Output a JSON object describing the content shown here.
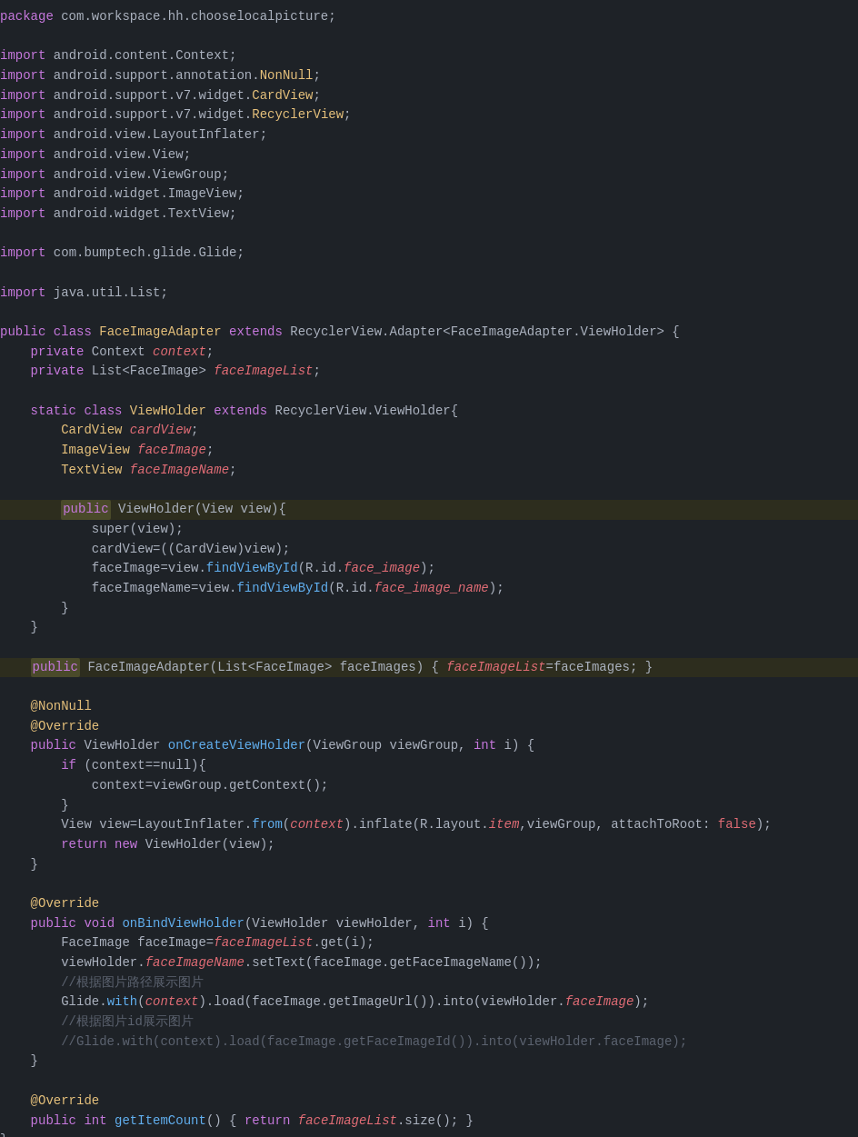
{
  "lines": [
    {
      "id": 1,
      "tokens": [
        {
          "t": "kw-package",
          "v": "package"
        },
        {
          "t": "normal",
          "v": " com.workspace.hh.chooselocalpicture;"
        }
      ]
    },
    {
      "id": 2,
      "tokens": []
    },
    {
      "id": 3,
      "tokens": [
        {
          "t": "kw-import",
          "v": "import"
        },
        {
          "t": "normal",
          "v": " android.content.Context;"
        }
      ]
    },
    {
      "id": 4,
      "tokens": [
        {
          "t": "kw-import",
          "v": "import"
        },
        {
          "t": "normal",
          "v": " android.support.annotation."
        },
        {
          "t": "ann",
          "v": "NonNull"
        },
        {
          "t": "normal",
          "v": ";"
        }
      ]
    },
    {
      "id": 5,
      "tokens": [
        {
          "t": "kw-import",
          "v": "import"
        },
        {
          "t": "normal",
          "v": " android.support.v7.widget."
        },
        {
          "t": "type-name",
          "v": "CardView"
        },
        {
          "t": "normal",
          "v": ";"
        }
      ]
    },
    {
      "id": 6,
      "tokens": [
        {
          "t": "kw-import",
          "v": "import"
        },
        {
          "t": "normal",
          "v": " android.support.v7.widget."
        },
        {
          "t": "type-name",
          "v": "RecyclerView"
        },
        {
          "t": "normal",
          "v": ";"
        }
      ]
    },
    {
      "id": 7,
      "tokens": [
        {
          "t": "kw-import",
          "v": "import"
        },
        {
          "t": "normal",
          "v": " android.view.LayoutInflater;"
        }
      ]
    },
    {
      "id": 8,
      "tokens": [
        {
          "t": "kw-import",
          "v": "import"
        },
        {
          "t": "normal",
          "v": " android.view.View;"
        }
      ]
    },
    {
      "id": 9,
      "tokens": [
        {
          "t": "kw-import",
          "v": "import"
        },
        {
          "t": "normal",
          "v": " android.view.ViewGroup;"
        }
      ]
    },
    {
      "id": 10,
      "tokens": [
        {
          "t": "kw-import",
          "v": "import"
        },
        {
          "t": "normal",
          "v": " android.widget.ImageView;"
        }
      ]
    },
    {
      "id": 11,
      "tokens": [
        {
          "t": "kw-import",
          "v": "import"
        },
        {
          "t": "normal",
          "v": " android.widget.TextView;"
        }
      ]
    },
    {
      "id": 12,
      "tokens": []
    },
    {
      "id": 13,
      "tokens": [
        {
          "t": "kw-import",
          "v": "import"
        },
        {
          "t": "normal",
          "v": " com.bumptech.glide.Glide;"
        }
      ]
    },
    {
      "id": 14,
      "tokens": []
    },
    {
      "id": 15,
      "tokens": [
        {
          "t": "kw-import",
          "v": "import"
        },
        {
          "t": "normal",
          "v": " java.util.List;"
        }
      ]
    },
    {
      "id": 16,
      "tokens": []
    },
    {
      "id": 17,
      "tokens": [
        {
          "t": "kw-public",
          "v": "public"
        },
        {
          "t": "normal",
          "v": " "
        },
        {
          "t": "kw-class",
          "v": "class"
        },
        {
          "t": "normal",
          "v": " "
        },
        {
          "t": "type-name",
          "v": "FaceImageAdapter"
        },
        {
          "t": "normal",
          "v": " "
        },
        {
          "t": "kw-extends",
          "v": "extends"
        },
        {
          "t": "normal",
          "v": " RecyclerView.Adapter<FaceImageAdapter.ViewHolder> {"
        }
      ]
    },
    {
      "id": 18,
      "tokens": [
        {
          "t": "normal",
          "v": "    "
        },
        {
          "t": "kw-private",
          "v": "private"
        },
        {
          "t": "normal",
          "v": " Context "
        },
        {
          "t": "field-italic",
          "v": "context"
        },
        {
          "t": "normal",
          "v": ";"
        }
      ]
    },
    {
      "id": 19,
      "tokens": [
        {
          "t": "normal",
          "v": "    "
        },
        {
          "t": "kw-private",
          "v": "private"
        },
        {
          "t": "normal",
          "v": " List<FaceImage> "
        },
        {
          "t": "field-italic",
          "v": "faceImageList"
        },
        {
          "t": "normal",
          "v": ";"
        }
      ]
    },
    {
      "id": 20,
      "tokens": []
    },
    {
      "id": 21,
      "tokens": [
        {
          "t": "normal",
          "v": "    "
        },
        {
          "t": "kw-static",
          "v": "static"
        },
        {
          "t": "normal",
          "v": " "
        },
        {
          "t": "kw-class",
          "v": "class"
        },
        {
          "t": "normal",
          "v": " "
        },
        {
          "t": "type-name",
          "v": "ViewHolder"
        },
        {
          "t": "normal",
          "v": " "
        },
        {
          "t": "kw-extends",
          "v": "extends"
        },
        {
          "t": "normal",
          "v": " RecyclerView.ViewHolder{"
        }
      ]
    },
    {
      "id": 22,
      "tokens": [
        {
          "t": "normal",
          "v": "        "
        },
        {
          "t": "type-name",
          "v": "CardView"
        },
        {
          "t": "normal",
          "v": " "
        },
        {
          "t": "field-italic",
          "v": "cardView"
        },
        {
          "t": "normal",
          "v": ";"
        }
      ]
    },
    {
      "id": 23,
      "tokens": [
        {
          "t": "normal",
          "v": "        "
        },
        {
          "t": "type-name",
          "v": "ImageView"
        },
        {
          "t": "normal",
          "v": " "
        },
        {
          "t": "field-italic",
          "v": "faceImage"
        },
        {
          "t": "normal",
          "v": ";"
        }
      ]
    },
    {
      "id": 24,
      "tokens": [
        {
          "t": "normal",
          "v": "        "
        },
        {
          "t": "type-name",
          "v": "TextView"
        },
        {
          "t": "normal",
          "v": " "
        },
        {
          "t": "field-italic",
          "v": "faceImageName"
        },
        {
          "t": "normal",
          "v": ";"
        }
      ]
    },
    {
      "id": 25,
      "tokens": []
    },
    {
      "id": 26,
      "tokens": [
        {
          "t": "normal",
          "v": "        "
        },
        {
          "t": "kw-public-hl",
          "v": "public"
        },
        {
          "t": "normal",
          "v": " ViewHolder(View view){"
        }
      ]
    },
    {
      "id": 27,
      "tokens": [
        {
          "t": "normal",
          "v": "            super(view);"
        }
      ]
    },
    {
      "id": 28,
      "tokens": [
        {
          "t": "normal",
          "v": "            cardView=((CardView)view);"
        }
      ]
    },
    {
      "id": 29,
      "tokens": [
        {
          "t": "normal",
          "v": "            faceImage=view."
        },
        {
          "t": "method",
          "v": "findViewById"
        },
        {
          "t": "normal",
          "v": "(R.id."
        },
        {
          "t": "field-italic",
          "v": "face_image"
        },
        {
          "t": "normal",
          "v": ");"
        }
      ]
    },
    {
      "id": 30,
      "tokens": [
        {
          "t": "normal",
          "v": "            faceImageName=view."
        },
        {
          "t": "method",
          "v": "findViewById"
        },
        {
          "t": "normal",
          "v": "(R.id."
        },
        {
          "t": "field-italic",
          "v": "face_image_name"
        },
        {
          "t": "normal",
          "v": ");"
        }
      ]
    },
    {
      "id": 31,
      "tokens": [
        {
          "t": "normal",
          "v": "        }"
        }
      ]
    },
    {
      "id": 32,
      "tokens": [
        {
          "t": "normal",
          "v": "    }"
        }
      ]
    },
    {
      "id": 33,
      "tokens": []
    },
    {
      "id": 34,
      "tokens": [
        {
          "t": "normal",
          "v": "    "
        },
        {
          "t": "kw-public-hl",
          "v": "public"
        },
        {
          "t": "normal",
          "v": " FaceImageAdapter(List<FaceImage> faceImages) { "
        },
        {
          "t": "field-italic",
          "v": "faceImageList"
        },
        {
          "t": "normal",
          "v": "=faceImages; }"
        }
      ]
    },
    {
      "id": 35,
      "tokens": []
    },
    {
      "id": 36,
      "tokens": [
        {
          "t": "normal",
          "v": "    "
        },
        {
          "t": "ann",
          "v": "@NonNull"
        }
      ]
    },
    {
      "id": 37,
      "tokens": [
        {
          "t": "normal",
          "v": "    "
        },
        {
          "t": "ann",
          "v": "@Override"
        }
      ]
    },
    {
      "id": 38,
      "tokens": [
        {
          "t": "normal",
          "v": "    "
        },
        {
          "t": "kw-public",
          "v": "public"
        },
        {
          "t": "normal",
          "v": " ViewHolder "
        },
        {
          "t": "method",
          "v": "onCreateViewHolder"
        },
        {
          "t": "normal",
          "v": "(ViewGroup viewGroup, "
        },
        {
          "t": "kw-int",
          "v": "int"
        },
        {
          "t": "normal",
          "v": " i) {"
        }
      ]
    },
    {
      "id": 39,
      "tokens": [
        {
          "t": "normal",
          "v": "        "
        },
        {
          "t": "kw-if",
          "v": "if"
        },
        {
          "t": "normal",
          "v": " (context==null){"
        }
      ]
    },
    {
      "id": 40,
      "tokens": [
        {
          "t": "normal",
          "v": "            context=viewGroup.getContext();"
        }
      ]
    },
    {
      "id": 41,
      "tokens": [
        {
          "t": "normal",
          "v": "        }"
        }
      ]
    },
    {
      "id": 42,
      "tokens": [
        {
          "t": "normal",
          "v": "        View view=LayoutInflater."
        },
        {
          "t": "method",
          "v": "from"
        },
        {
          "t": "normal",
          "v": "("
        },
        {
          "t": "field-italic",
          "v": "context"
        },
        {
          "t": "normal",
          "v": ").inflate(R.layout."
        },
        {
          "t": "field-italic",
          "v": "item"
        },
        {
          "t": "normal",
          "v": ",viewGroup, "
        },
        {
          "t": "attach-kw",
          "v": "attachToRoot"
        },
        {
          "t": "normal",
          "v": ": "
        },
        {
          "t": "false-val",
          "v": "false"
        },
        {
          "t": "normal",
          "v": ");"
        }
      ]
    },
    {
      "id": 43,
      "tokens": [
        {
          "t": "normal",
          "v": "        "
        },
        {
          "t": "kw-return",
          "v": "return"
        },
        {
          "t": "normal",
          "v": " "
        },
        {
          "t": "kw-new",
          "v": "new"
        },
        {
          "t": "normal",
          "v": " ViewHolder(view);"
        }
      ]
    },
    {
      "id": 44,
      "tokens": [
        {
          "t": "normal",
          "v": "    }"
        }
      ]
    },
    {
      "id": 45,
      "tokens": []
    },
    {
      "id": 46,
      "tokens": [
        {
          "t": "normal",
          "v": "    "
        },
        {
          "t": "ann",
          "v": "@Override"
        }
      ]
    },
    {
      "id": 47,
      "tokens": [
        {
          "t": "normal",
          "v": "    "
        },
        {
          "t": "kw-public",
          "v": "public"
        },
        {
          "t": "normal",
          "v": " "
        },
        {
          "t": "kw-void",
          "v": "void"
        },
        {
          "t": "normal",
          "v": " "
        },
        {
          "t": "method",
          "v": "onBindViewHolder"
        },
        {
          "t": "normal",
          "v": "(ViewHolder viewHolder, "
        },
        {
          "t": "kw-int",
          "v": "int"
        },
        {
          "t": "normal",
          "v": " i) {"
        }
      ]
    },
    {
      "id": 48,
      "tokens": [
        {
          "t": "normal",
          "v": "        FaceImage faceImage="
        },
        {
          "t": "field-italic",
          "v": "faceImageList"
        },
        {
          "t": "normal",
          "v": ".get(i);"
        }
      ]
    },
    {
      "id": 49,
      "tokens": [
        {
          "t": "normal",
          "v": "        viewHolder."
        },
        {
          "t": "field-italic",
          "v": "faceImageName"
        },
        {
          "t": "normal",
          "v": ".setText(faceImage.getFaceImageName());"
        }
      ]
    },
    {
      "id": 50,
      "tokens": [
        {
          "t": "comment",
          "v": "        //根据图片路径展示图片"
        }
      ]
    },
    {
      "id": 51,
      "tokens": [
        {
          "t": "normal",
          "v": "        Glide."
        },
        {
          "t": "method",
          "v": "with"
        },
        {
          "t": "normal",
          "v": "("
        },
        {
          "t": "field-italic",
          "v": "context"
        },
        {
          "t": "normal",
          "v": ").load(faceImage.getImageUrl()).into(viewHolder."
        },
        {
          "t": "field-italic",
          "v": "faceImage"
        },
        {
          "t": "normal",
          "v": ");"
        }
      ]
    },
    {
      "id": 52,
      "tokens": [
        {
          "t": "comment",
          "v": "        //根据图片id展示图片"
        }
      ]
    },
    {
      "id": 53,
      "tokens": [
        {
          "t": "comment",
          "v": "        //Glide.with(context).load(faceImage.getFaceImageId()).into(viewHolder.faceImage);"
        }
      ]
    },
    {
      "id": 54,
      "tokens": [
        {
          "t": "normal",
          "v": "    }"
        }
      ]
    },
    {
      "id": 55,
      "tokens": []
    },
    {
      "id": 56,
      "tokens": [
        {
          "t": "normal",
          "v": "    "
        },
        {
          "t": "ann",
          "v": "@Override"
        }
      ]
    },
    {
      "id": 57,
      "tokens": [
        {
          "t": "normal",
          "v": "    "
        },
        {
          "t": "kw-public",
          "v": "public"
        },
        {
          "t": "normal",
          "v": " "
        },
        {
          "t": "kw-int",
          "v": "int"
        },
        {
          "t": "normal",
          "v": " "
        },
        {
          "t": "method",
          "v": "getItemCount"
        },
        {
          "t": "normal",
          "v": "() { "
        },
        {
          "t": "kw-return",
          "v": "return"
        },
        {
          "t": "normal",
          "v": " "
        },
        {
          "t": "field-italic",
          "v": "faceImageList"
        },
        {
          "t": "normal",
          "v": ".size(); }"
        }
      ]
    },
    {
      "id": 58,
      "tokens": [
        {
          "t": "normal",
          "v": "}"
        }
      ]
    }
  ]
}
